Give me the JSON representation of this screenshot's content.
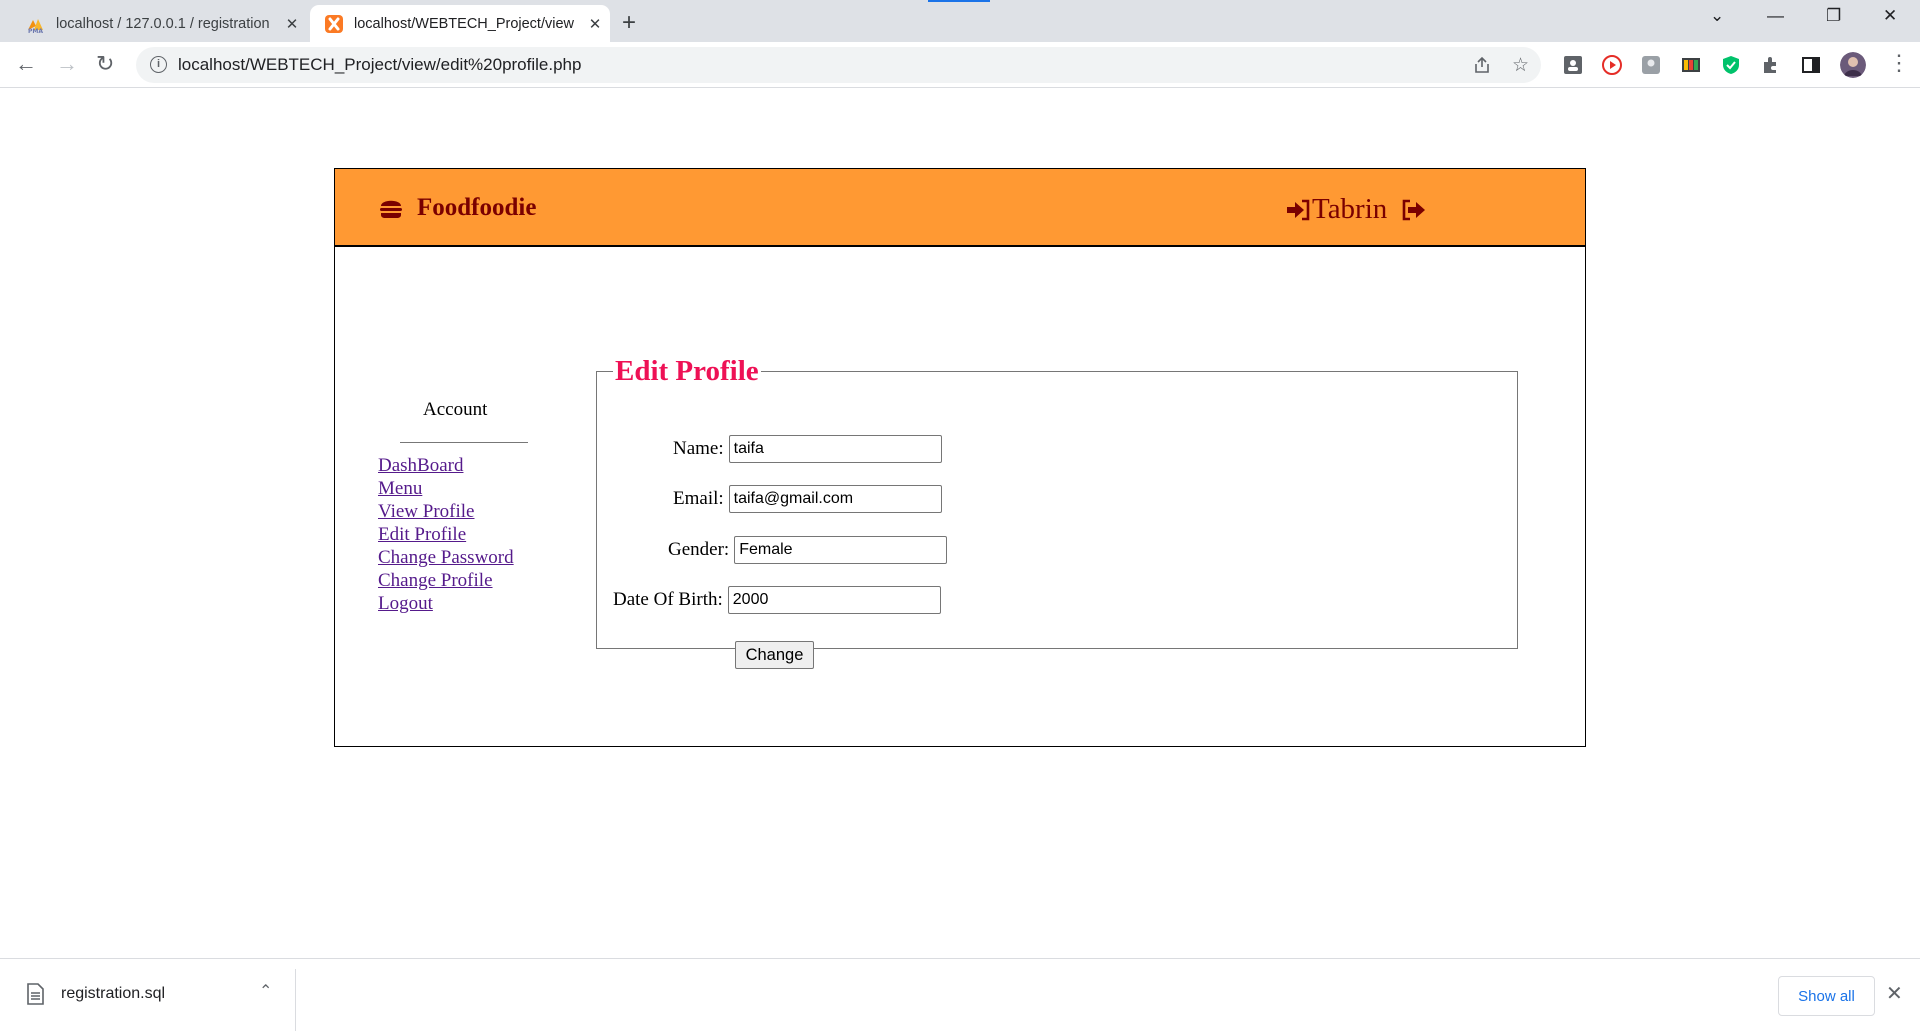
{
  "browser": {
    "tabs": [
      {
        "title": "localhost / 127.0.0.1 / registration",
        "active": false,
        "icon": "phpmyadmin-icon"
      },
      {
        "title": "localhost/WEBTECH_Project/view",
        "active": true,
        "icon": "xampp-icon"
      }
    ],
    "new_tab": "+",
    "url": "localhost/WEBTECH_Project/view/edit%20profile.php"
  },
  "site": {
    "brand": "Foodfoodie",
    "username": "Tabrin",
    "header_color": "#ff9933",
    "brand_color": "#7a0000"
  },
  "sidebar": {
    "heading": "Account",
    "links": [
      "DashBoard",
      "Menu",
      "View Profile",
      "Edit Profile",
      "Change Password",
      "Change Profile",
      "Logout"
    ]
  },
  "form": {
    "legend": "Edit Profile",
    "legend_color": "#ee1155",
    "name_label": "Name:",
    "name_value": "taifa",
    "email_label": "Email:",
    "email_value": "taifa@gmail.com",
    "gender_label": "Gender:",
    "gender_value": "Female",
    "dob_label": "Date Of Birth:",
    "dob_value": "2000",
    "submit_label": "Change"
  },
  "downloads": {
    "file": "registration.sql",
    "show_all": "Show all"
  }
}
